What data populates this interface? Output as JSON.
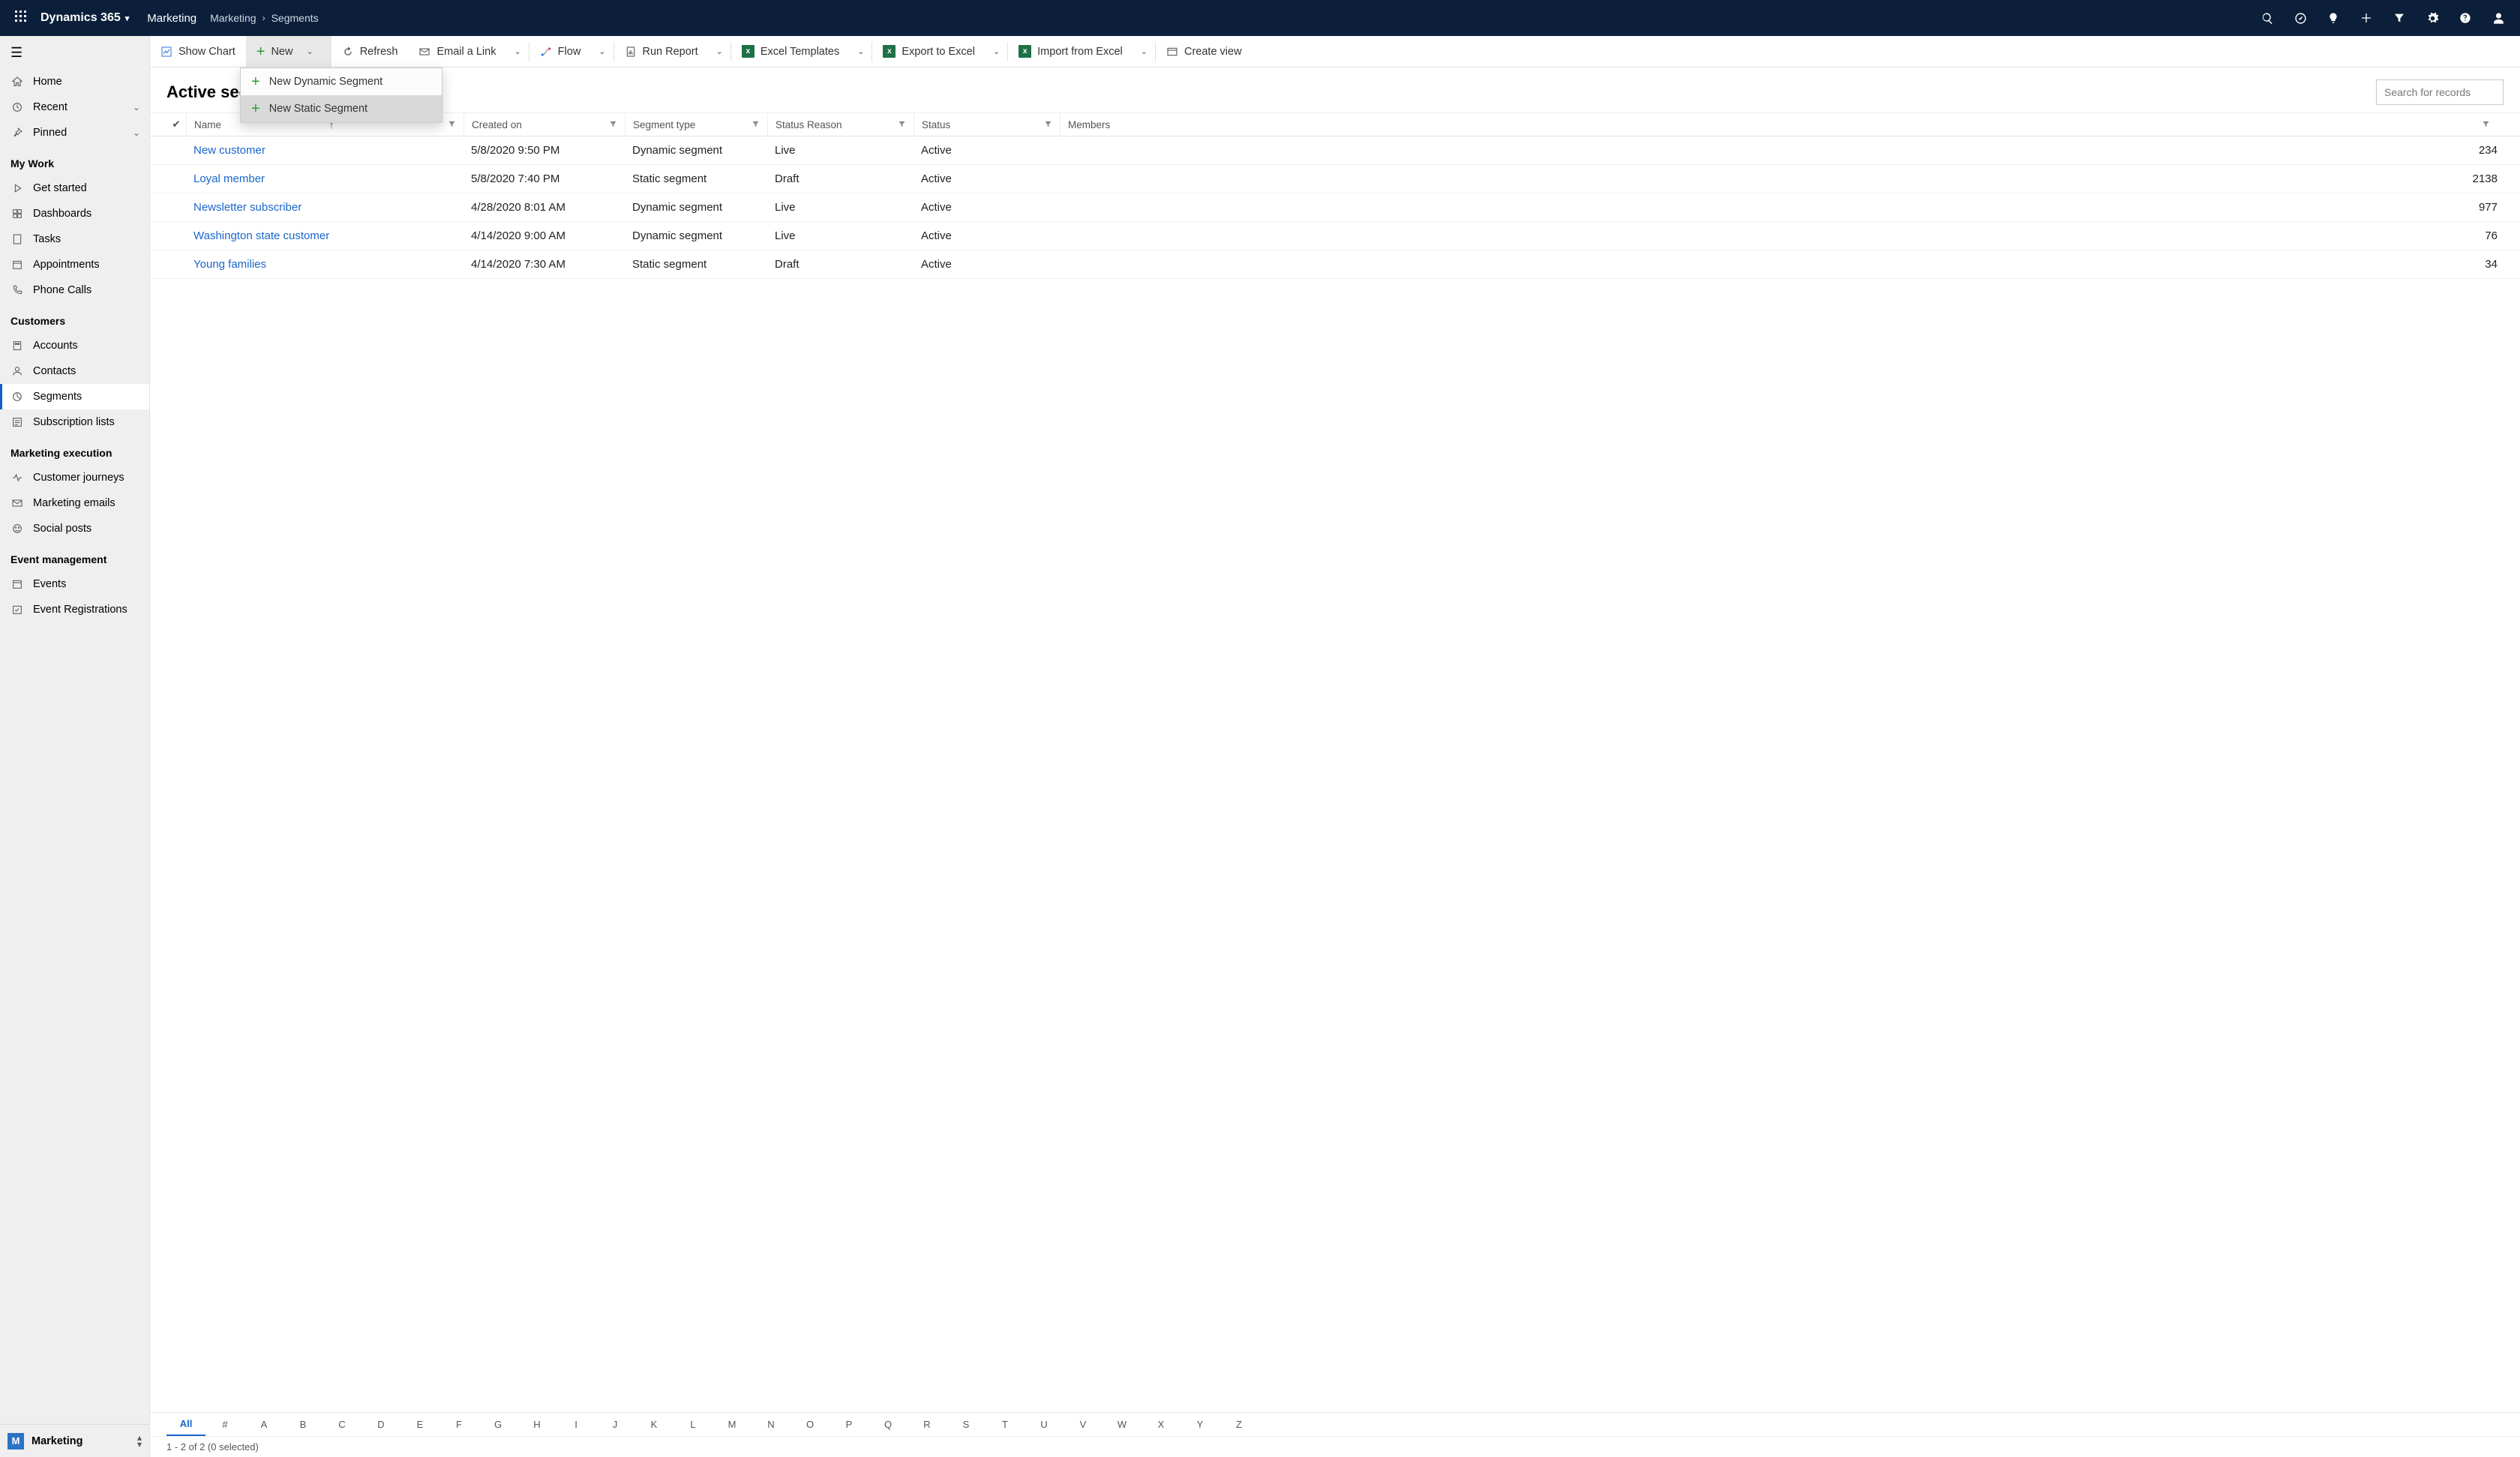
{
  "topbar": {
    "brand": "Dynamics 365",
    "area": "Marketing",
    "crumb1": "Marketing",
    "crumb2": "Segments"
  },
  "sidebar": {
    "top": {
      "home": "Home",
      "recent": "Recent",
      "pinned": "Pinned"
    },
    "groups": [
      {
        "header": "My Work",
        "items": [
          {
            "key": "getstarted",
            "label": "Get started"
          },
          {
            "key": "dashboards",
            "label": "Dashboards"
          },
          {
            "key": "tasks",
            "label": "Tasks"
          },
          {
            "key": "appointments",
            "label": "Appointments"
          },
          {
            "key": "phonecalls",
            "label": "Phone Calls"
          }
        ]
      },
      {
        "header": "Customers",
        "items": [
          {
            "key": "accounts",
            "label": "Accounts"
          },
          {
            "key": "contacts",
            "label": "Contacts"
          },
          {
            "key": "segments",
            "label": "Segments",
            "selected": true
          },
          {
            "key": "sublists",
            "label": "Subscription lists"
          }
        ]
      },
      {
        "header": "Marketing execution",
        "items": [
          {
            "key": "journeys",
            "label": "Customer journeys"
          },
          {
            "key": "memails",
            "label": "Marketing emails"
          },
          {
            "key": "social",
            "label": "Social posts"
          }
        ]
      },
      {
        "header": "Event management",
        "items": [
          {
            "key": "events",
            "label": "Events"
          },
          {
            "key": "eventreg",
            "label": "Event Registrations"
          }
        ]
      }
    ],
    "footer": {
      "badge": "M",
      "label": "Marketing"
    }
  },
  "cmdbar": {
    "showchart": "Show Chart",
    "new": "New",
    "refresh": "Refresh",
    "emaillink": "Email a Link",
    "flow": "Flow",
    "runreport": "Run Report",
    "exceltmpl": "Excel Templates",
    "exportexcel": "Export to Excel",
    "importexcel": "Import from Excel",
    "createview": "Create view"
  },
  "dropdown": {
    "item1": "New Dynamic Segment",
    "item2": "New Static Segment"
  },
  "view": {
    "title": "Active segments",
    "search_placeholder": "Search for records"
  },
  "columns": {
    "name": "Name",
    "created": "Created on",
    "type": "Segment type",
    "reason": "Status Reason",
    "status": "Status",
    "members": "Members"
  },
  "rows": [
    {
      "name": "New customer",
      "created": "5/8/2020 9:50 PM",
      "type": "Dynamic segment",
      "reason": "Live",
      "status": "Active",
      "members": "234"
    },
    {
      "name": "Loyal member",
      "created": "5/8/2020 7:40 PM",
      "type": "Static segment",
      "reason": "Draft",
      "status": "Active",
      "members": "2138"
    },
    {
      "name": "Newsletter subscriber",
      "created": "4/28/2020 8:01 AM",
      "type": "Dynamic segment",
      "reason": "Live",
      "status": "Active",
      "members": "977"
    },
    {
      "name": "Washington state customer",
      "created": "4/14/2020 9:00 AM",
      "type": "Dynamic segment",
      "reason": "Live",
      "status": "Active",
      "members": "76"
    },
    {
      "name": "Young families",
      "created": "4/14/2020 7:30 AM",
      "type": "Static segment",
      "reason": "Draft",
      "status": "Active",
      "members": "34"
    }
  ],
  "alphabar": [
    "All",
    "#",
    "A",
    "B",
    "C",
    "D",
    "E",
    "F",
    "G",
    "H",
    "I",
    "J",
    "K",
    "L",
    "M",
    "N",
    "O",
    "P",
    "Q",
    "R",
    "S",
    "T",
    "U",
    "V",
    "W",
    "X",
    "Y",
    "Z"
  ],
  "status": "1 - 2 of 2 (0 selected)"
}
